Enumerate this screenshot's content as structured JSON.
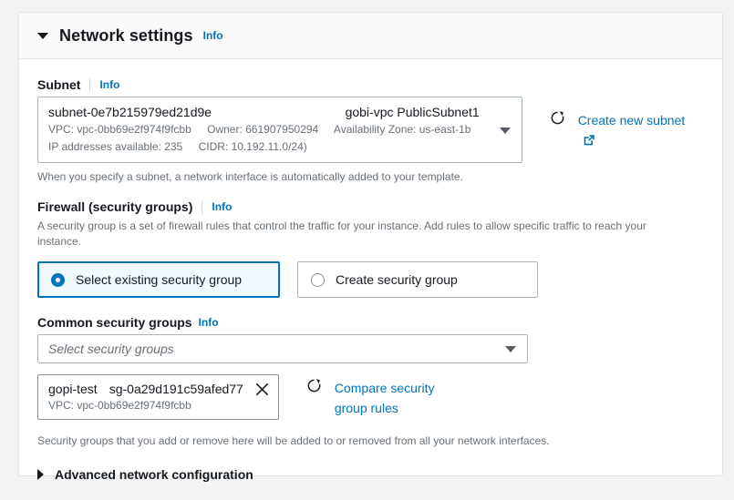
{
  "panel": {
    "title": "Network settings",
    "info_label": "Info",
    "collapse_icon": "caret-down-icon"
  },
  "subnet": {
    "label": "Subnet",
    "info_label": "Info",
    "value_id": "subnet-0e7b215979ed21d9e",
    "value_name": "gobi-vpc PublicSubnet1",
    "vpc": "VPC: vpc-0bb69e2f974f9fcbb",
    "owner": "Owner: 661907950294",
    "az": "Availability Zone: us-east-1b",
    "ips": "IP addresses available: 235",
    "cidr": "CIDR: 10.192.11.0/24)",
    "create_link": "Create new subnet",
    "hint": "When you specify a subnet, a network interface is automatically added to your template."
  },
  "firewall": {
    "label": "Firewall (security groups)",
    "info_label": "Info",
    "description": "A security group is a set of firewall rules that control the traffic for your instance. Add rules to allow specific traffic to reach your instance.",
    "options": [
      {
        "label": "Select existing security group",
        "selected": true
      },
      {
        "label": "Create security group",
        "selected": false
      }
    ]
  },
  "common_security_groups": {
    "label": "Common security groups",
    "info_label": "Info",
    "placeholder": "Select security groups",
    "selected_token": {
      "name": "gopi-test",
      "id": "sg-0a29d191c59afed77",
      "vpc": "VPC: vpc-0bb69e2f974f9fcbb"
    },
    "compare_link": "Compare security group rules",
    "footnote": "Security groups that you add or remove here will be added to or removed from all your network interfaces."
  },
  "advanced": {
    "label": "Advanced network configuration",
    "expand_icon": "caret-right-icon"
  },
  "colors": {
    "link": "#0073bb",
    "text": "#16191f",
    "muted": "#687078",
    "border": "#aab7b8",
    "selected_tile_bg": "#f1faff",
    "panel_header_bg": "#fafafa",
    "page_bg": "#f2f3f3"
  }
}
